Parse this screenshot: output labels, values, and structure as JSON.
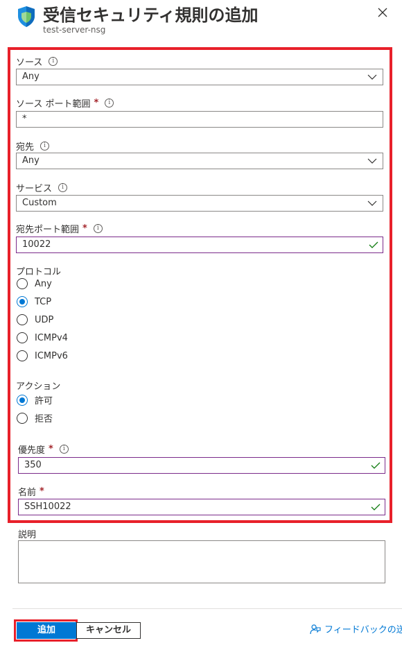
{
  "header": {
    "title": "受信セキュリティ規則の追加",
    "subtitle": "test-server-nsg",
    "shield_icon": "shield-icon",
    "close_icon": "close-icon"
  },
  "form": {
    "source": {
      "label": "ソース",
      "value": "Any"
    },
    "source_port": {
      "label": "ソース ポート範囲",
      "required": "*",
      "value": "*"
    },
    "destination": {
      "label": "宛先",
      "value": "Any"
    },
    "service": {
      "label": "サービス",
      "value": "Custom"
    },
    "dest_port": {
      "label": "宛先ポート範囲",
      "required": "*",
      "value": "10022"
    },
    "protocol": {
      "label": "プロトコル",
      "options": [
        "Any",
        "TCP",
        "UDP",
        "ICMPv4",
        "ICMPv6"
      ],
      "selected": "TCP"
    },
    "action": {
      "label": "アクション",
      "options": [
        "許可",
        "拒否"
      ],
      "selected": "許可"
    },
    "priority": {
      "label": "優先度",
      "required": "*",
      "value": "350"
    },
    "name": {
      "label": "名前",
      "required": "*",
      "value": "SSH10022"
    },
    "description": {
      "label": "説明",
      "value": ""
    }
  },
  "footer": {
    "add_label": "追加",
    "cancel_label": "キャンセル",
    "feedback_label": "フィードバックの送信"
  },
  "colors": {
    "accent": "#0078d4",
    "highlight": "#e8202a",
    "valid_check": "#107c10",
    "required": "#a4262c"
  }
}
